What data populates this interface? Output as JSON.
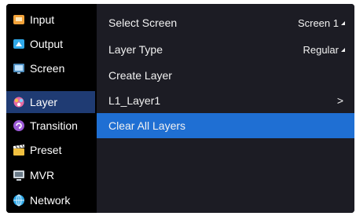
{
  "sidebar": {
    "items": [
      {
        "label": "Input",
        "icon": "input-icon",
        "color": "#f2a23a"
      },
      {
        "label": "Output",
        "icon": "output-icon",
        "color": "#2fa8e8"
      },
      {
        "label": "Screen",
        "icon": "screen-icon",
        "color": "#6ec1ff"
      },
      {
        "label": "Layer",
        "icon": "layer-icon",
        "color": "#e76aa1",
        "selected": true
      },
      {
        "label": "Transition",
        "icon": "transition-icon",
        "color": "#9b59d6"
      },
      {
        "label": "Preset",
        "icon": "preset-icon",
        "color": "#f0c040"
      },
      {
        "label": "MVR",
        "icon": "mvr-icon",
        "color": "#cfd6dd"
      },
      {
        "label": "Network",
        "icon": "network-icon",
        "color": "#2fa8e8"
      }
    ]
  },
  "menu": {
    "rows": [
      {
        "label": "Select Screen",
        "value": "Screen 1"
      },
      {
        "label": "Layer Type",
        "value": "Regular"
      },
      {
        "label": "Create Layer"
      },
      {
        "label": "L1_Layer1",
        "arrow": ">"
      },
      {
        "label": "Clear All Layers",
        "active": true
      }
    ]
  }
}
